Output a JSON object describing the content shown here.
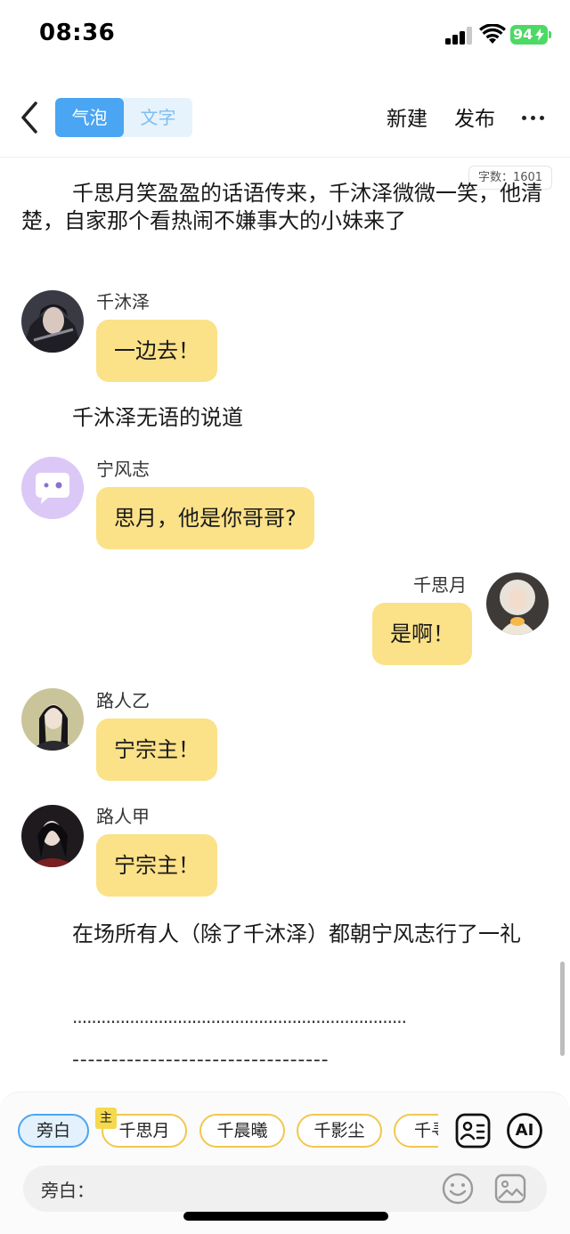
{
  "status_bar": {
    "time": "08:36",
    "battery": "94"
  },
  "nav": {
    "tabs": [
      {
        "label": "气泡",
        "active": true
      },
      {
        "label": "文字",
        "active": false
      }
    ],
    "new_label": "新建",
    "publish_label": "发布"
  },
  "word_count": "字数：1601",
  "story": {
    "narration_1": "千思月笑盈盈的话语传来，千沐泽微微一笑，他清楚，自家那个看热闹不嫌事大的小妹来了",
    "msg_1": {
      "name": "千沐泽",
      "text": "一边去！"
    },
    "narration_2": "千沐泽无语的说道",
    "msg_2": {
      "name": "宁风志",
      "text": "思月，他是你哥哥?"
    },
    "msg_3": {
      "name": "千思月",
      "text": "是啊！"
    },
    "msg_4": {
      "name": "路人乙",
      "text": "宁宗主！"
    },
    "msg_5": {
      "name": "路人甲",
      "text": "宁宗主！"
    },
    "narration_3": "在场所有人（除了千沐泽）都朝宁风志行了一礼",
    "dots": "......................................................................",
    "dashes": "---------------------------------"
  },
  "composer": {
    "roles": [
      "旁白",
      "千思月",
      "千晨曦",
      "千影尘",
      "千寻"
    ],
    "main_tag": "主",
    "ai_label": "AI",
    "input_label": "旁白："
  },
  "colors": {
    "accent": "#4aa5f2",
    "bubble": "#fbe188",
    "chip_border": "#f2c74e"
  }
}
